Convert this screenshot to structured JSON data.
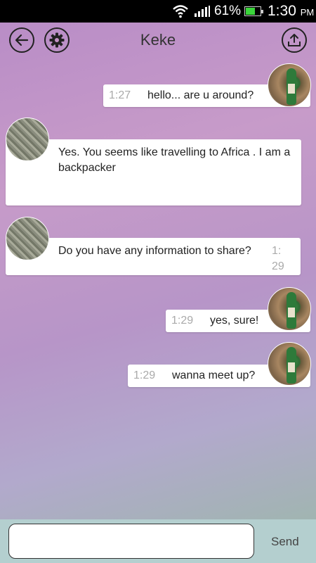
{
  "status_bar": {
    "battery_percent": "61%",
    "time": "1:30",
    "time_suffix": "PM",
    "icons": [
      "wifi-icon",
      "signal-icon",
      "battery-icon"
    ]
  },
  "header": {
    "title": "Keke",
    "back_icon": "arrow-left-icon",
    "settings_icon": "gear-icon",
    "share_icon": "upload-icon"
  },
  "messages": [
    {
      "from": "self",
      "time": "1:27",
      "text": "hello... are u around?"
    },
    {
      "from": "other",
      "time": "",
      "text": "Yes. You seems like travelling to Africa . I am a backpacker"
    },
    {
      "from": "other",
      "time": "1:29",
      "text": "Do you have any information to share?"
    },
    {
      "from": "self",
      "time": "1:29",
      "text": "yes, sure!"
    },
    {
      "from": "self",
      "time": "1:29",
      "text": "wanna meet up?"
    }
  ],
  "composer": {
    "input_value": "",
    "send_label": "Send"
  },
  "colors": {
    "bg_top": "#b78bc6",
    "bg_bottom": "#9ab9a7",
    "composer_bg": "#b4cfcf",
    "battery_green": "#3bd53b"
  }
}
